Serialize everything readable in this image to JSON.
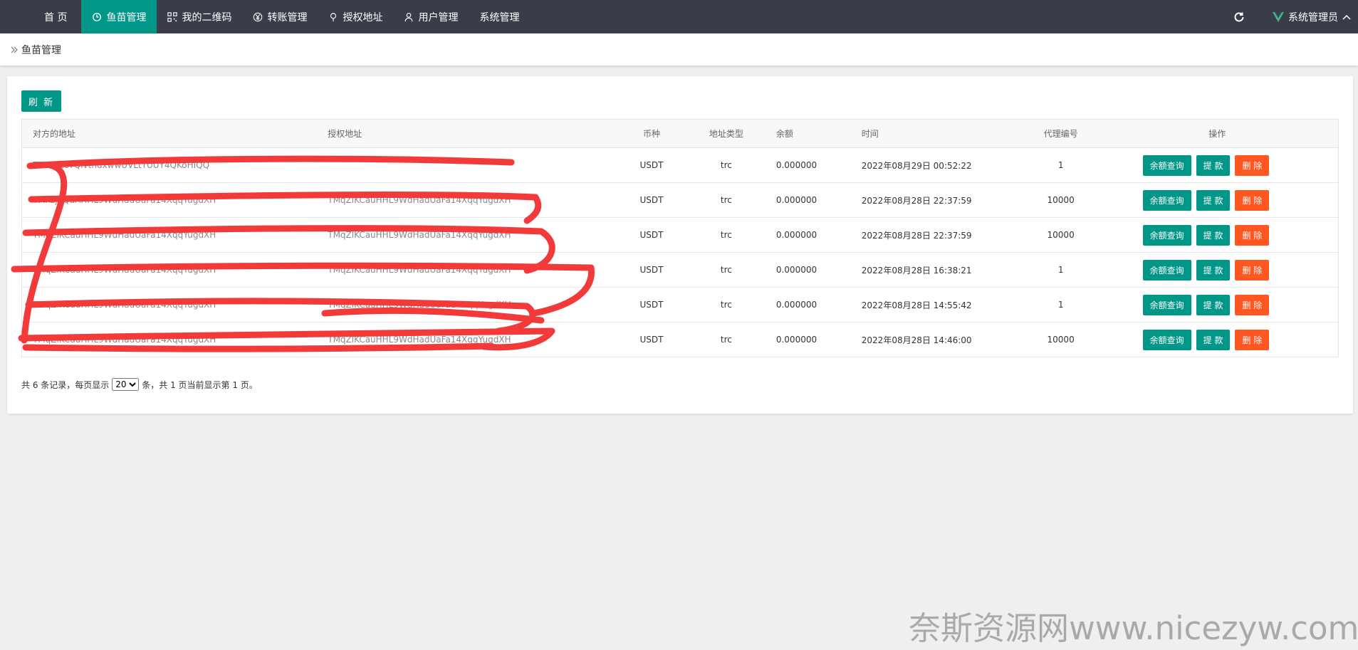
{
  "nav": {
    "items": [
      {
        "label": "首 页",
        "icon": "none",
        "active": false
      },
      {
        "label": "鱼苗管理",
        "icon": "fish-icon",
        "active": true
      },
      {
        "label": "我的二维码",
        "icon": "qrcode-icon",
        "active": false
      },
      {
        "label": "转账管理",
        "icon": "yen-icon",
        "active": false
      },
      {
        "label": "授权地址",
        "icon": "location-pin-icon",
        "active": false
      },
      {
        "label": "用户管理",
        "icon": "user-icon",
        "active": false
      },
      {
        "label": "系统管理",
        "icon": "none",
        "active": false
      }
    ],
    "user_label": "系统管理员",
    "bg_color": "#393d49",
    "active_color": "#009688"
  },
  "breadcrumb": {
    "current": "鱼苗管理"
  },
  "toolbar": {
    "refresh_label": "刷 新"
  },
  "table": {
    "headers": [
      "对方的地址",
      "授权地址",
      "币种",
      "地址类型",
      "余额",
      "时间",
      "代理编号",
      "操作"
    ],
    "rows": [
      {
        "from_address": "TThKSzcYQivthdxwwUVLtTUUY4QKoHIQQ",
        "auth_address": "",
        "currency": "USDT",
        "type": "trc",
        "balance": "0.000000",
        "time": "2022年08月29日 00:52:22",
        "agent": "1"
      },
      {
        "from_address": "TMxzjKQaAHHL9WdHadUaFa14XqqYugdXH",
        "auth_address": "TMqZiKCauHHL9WdHadUaFa14XqqYugdXH",
        "currency": "USDT",
        "type": "trc",
        "balance": "0.000000",
        "time": "2022年08月28日 22:37:59",
        "agent": "10000"
      },
      {
        "from_address": "TMqZlKCauHHL9WdHadUaFa14XqqYugdXH",
        "auth_address": "TMqZlKCauHHL9WdHadUaFa14XqqYugdXH",
        "currency": "USDT",
        "type": "trc",
        "balance": "0.000000",
        "time": "2022年08月28日 22:37:59",
        "agent": "10000"
      },
      {
        "from_address": "TMqZlKCauHHL9WdHadUaFa14XqqYugdXH",
        "auth_address": "TMqZlKCauHHL9WdHadUaFa14XqqYugdXH",
        "currency": "USDT",
        "type": "trc",
        "balance": "0.000000",
        "time": "2022年08月28日 16:38:21",
        "agent": "1"
      },
      {
        "from_address": "TMqZlKCauHHL9WdHadUaFa14XqqYugdXH",
        "auth_address": "TMqZiKCauHHL9WdHadUaFa14XqqYugdXH",
        "currency": "USDT",
        "type": "trc",
        "balance": "0.000000",
        "time": "2022年08月28日 14:55:42",
        "agent": "1"
      },
      {
        "from_address": "TMqZlKCauHHL9WdHadUaFa14XqqYugdXH",
        "auth_address": "TMqZlKCauHHL9WdHadUaFa14XqqYugdXH",
        "currency": "USDT",
        "type": "trc",
        "balance": "0.000000",
        "time": "2022年08月28日 14:46:00",
        "agent": "10000"
      }
    ],
    "op_balance": "余额查询",
    "op_withdraw": "提 款",
    "op_delete": "删 除"
  },
  "pager": {
    "prefix": "共 6 条记录，每页显示",
    "page_size": "20",
    "suffix": "条，共 1 页当前显示第 1 页。"
  },
  "watermark": "奈斯资源网www.nicezyw.com",
  "colors": {
    "accent": "#009688",
    "danger": "#ff5722",
    "scribble": "#f23a3a"
  }
}
